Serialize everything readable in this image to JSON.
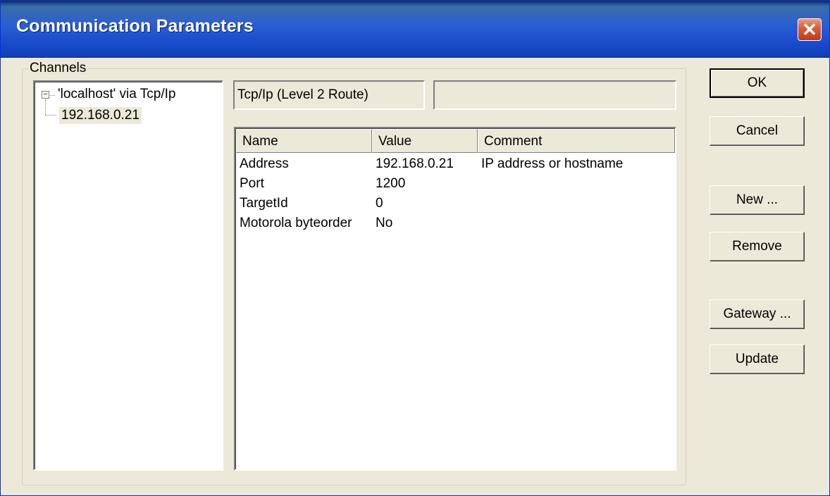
{
  "window": {
    "title": "Communication Parameters",
    "close_symbol": "✕"
  },
  "channels": {
    "legend": "Channels",
    "tree": {
      "root_expander": "−",
      "root_label": "'localhost' via Tcp/Ip",
      "child_label": "192.168.0.21"
    }
  },
  "driver": {
    "name": "Tcp/Ip (Level 2 Route)",
    "extra": ""
  },
  "table": {
    "headers": [
      "Name",
      "Value",
      "Comment"
    ],
    "rows": [
      [
        "Address",
        "192.168.0.21",
        "IP address or hostname"
      ],
      [
        "Port",
        "1200",
        ""
      ],
      [
        "TargetId",
        "0",
        ""
      ],
      [
        "Motorola byteorder",
        "No",
        ""
      ]
    ]
  },
  "buttons": {
    "ok": "OK",
    "cancel": "Cancel",
    "new": "New ...",
    "remove": "Remove",
    "gateway": "Gateway ...",
    "update": "Update"
  },
  "colors": {
    "titlebar": "#1848c8",
    "face": "#ece9d8",
    "close": "#d86040"
  }
}
